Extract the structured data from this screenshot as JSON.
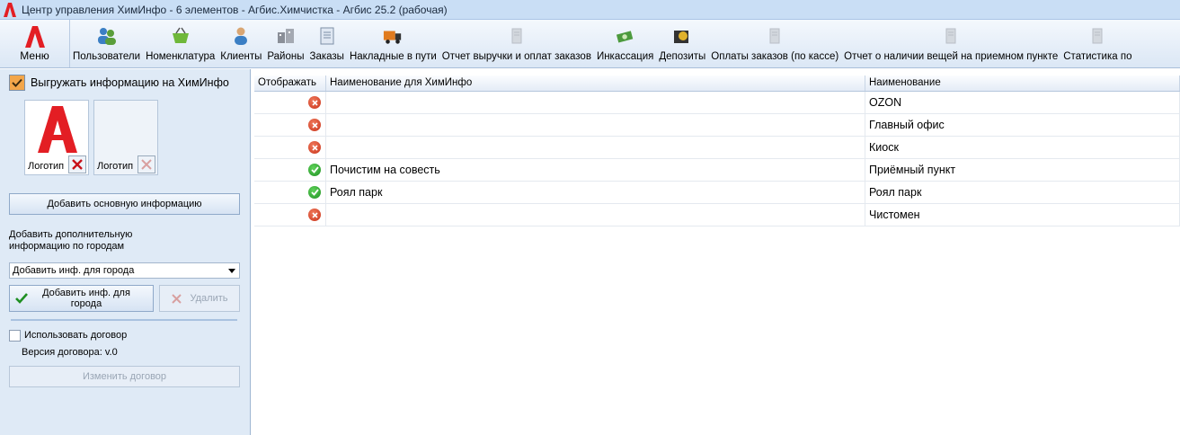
{
  "window": {
    "title": "Центр управления ХимИнфо - 6 элементов - Агбис.Химчистка - Агбис 25.2 (рабочая)"
  },
  "ribbon": {
    "menu_label": "Меню",
    "items": [
      {
        "label": "Пользователи",
        "icon": "users-icon"
      },
      {
        "label": "Номенклатура",
        "icon": "basket-icon"
      },
      {
        "label": "Клиенты",
        "icon": "client-icon"
      },
      {
        "label": "Районы",
        "icon": "districts-icon"
      },
      {
        "label": "Заказы",
        "icon": "orders-icon"
      },
      {
        "label": "Накладные в пути",
        "icon": "truck-icon"
      },
      {
        "label": "Отчет выручки и оплат заказов",
        "icon": "report-icon"
      },
      {
        "label": "Инкассация",
        "icon": "money-icon"
      },
      {
        "label": "Депозиты",
        "icon": "deposit-icon"
      },
      {
        "label": "Оплаты заказов (по кассе)",
        "icon": "report-icon"
      },
      {
        "label": "Отчет о наличии вещей на приемном пункте",
        "icon": "report-icon"
      },
      {
        "label": "Статистика по",
        "icon": "report-icon"
      }
    ]
  },
  "left_panel": {
    "export_label": "Выгружать информацию на ХимИнфо",
    "logo1_caption": "Логотип",
    "logo2_caption": "Логотип",
    "add_main_button": "Добавить основную информацию",
    "additional_info_label": "Добавить дополнительную информацию по городам",
    "city_select_value": "Добавить инф. для города",
    "add_city_button": "Добавить инф. для города",
    "delete_button": "Удалить",
    "use_contract_label": "Использовать договор",
    "contract_version_label": "Версия договора: v.0",
    "change_contract_button": "Изменить договор"
  },
  "grid": {
    "columns": [
      "Отображать",
      "Наименование для ХимИнфо",
      "Наименование"
    ],
    "rows": [
      {
        "display": false,
        "himinfo_name": "",
        "name": "OZON"
      },
      {
        "display": false,
        "himinfo_name": "",
        "name": "Главный офис"
      },
      {
        "display": false,
        "himinfo_name": "",
        "name": "Киоск"
      },
      {
        "display": true,
        "himinfo_name": "Почистим на совесть",
        "name": "Приёмный пункт"
      },
      {
        "display": true,
        "himinfo_name": "Роял парк",
        "name": "Роял парк"
      },
      {
        "display": false,
        "himinfo_name": "",
        "name": "Чистомен"
      }
    ]
  },
  "colors": {
    "accent_red": "#e31e24",
    "title_bar": "#c9def5",
    "panel": "#dfeaf6"
  }
}
